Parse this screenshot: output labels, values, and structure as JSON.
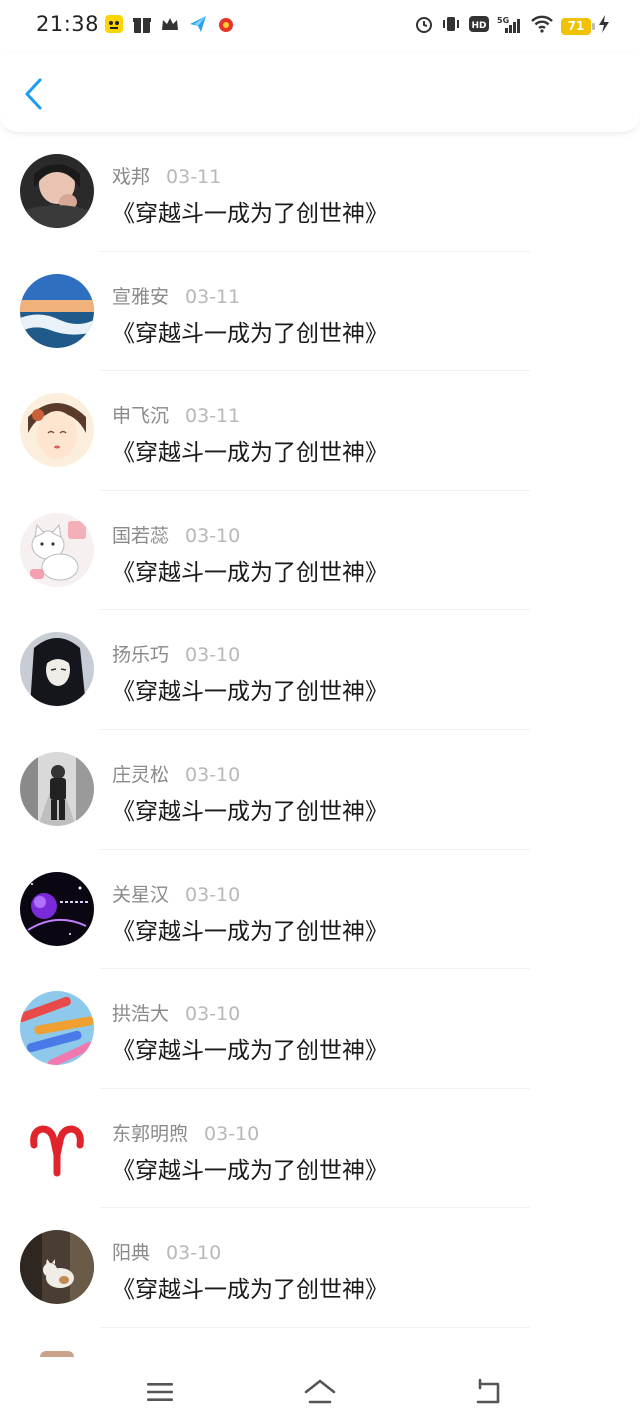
{
  "status_bar": {
    "time": "21:38",
    "battery_level": "71",
    "network": "5G",
    "hd_label": "HD"
  },
  "header": {
    "back_icon": "chevron-left-icon",
    "accent_color": "#1a9cf0"
  },
  "comments": [
    {
      "name": "戏邦",
      "date": "03-11",
      "text": "《穿越斗一成为了创世神》"
    },
    {
      "name": "宣雅安",
      "date": "03-11",
      "text": "《穿越斗一成为了创世神》"
    },
    {
      "name": "申飞沉",
      "date": "03-11",
      "text": "《穿越斗一成为了创世神》"
    },
    {
      "name": "国若蕊",
      "date": "03-10",
      "text": "《穿越斗一成为了创世神》"
    },
    {
      "name": "扬乐巧",
      "date": "03-10",
      "text": "《穿越斗一成为了创世神》"
    },
    {
      "name": "庄灵松",
      "date": "03-10",
      "text": "《穿越斗一成为了创世神》"
    },
    {
      "name": "关星汉",
      "date": "03-10",
      "text": "《穿越斗一成为了创世神》"
    },
    {
      "name": "拱浩大",
      "date": "03-10",
      "text": "《穿越斗一成为了创世神》"
    },
    {
      "name": "东郭明煦",
      "date": "03-10",
      "text": "《穿越斗一成为了创世神》"
    },
    {
      "name": "阳典",
      "date": "03-10",
      "text": "《穿越斗一成为了创世神》"
    }
  ],
  "nav_bar": {
    "menu_icon": "menu-icon",
    "home_icon": "home-icon",
    "back_icon": "back-icon"
  }
}
